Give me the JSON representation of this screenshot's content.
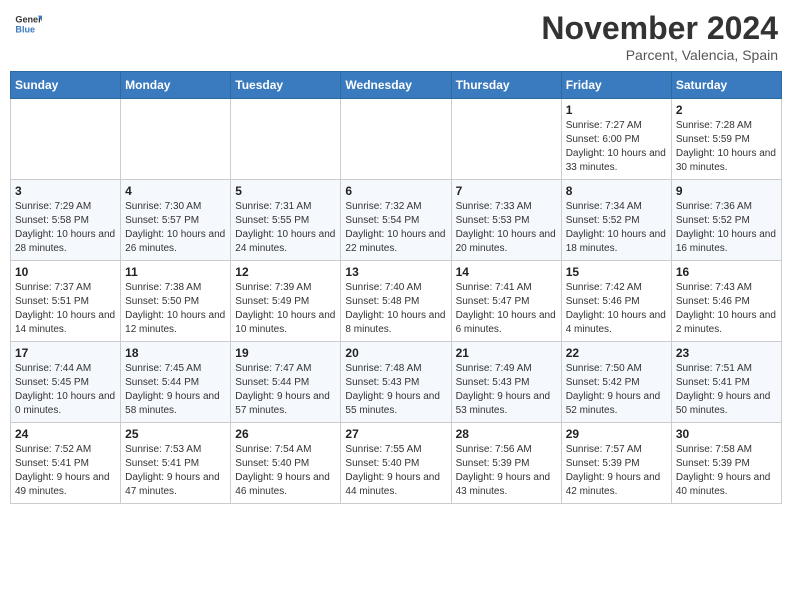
{
  "logo": {
    "line1": "General",
    "line2": "Blue"
  },
  "title": "November 2024",
  "subtitle": "Parcent, Valencia, Spain",
  "weekdays": [
    "Sunday",
    "Monday",
    "Tuesday",
    "Wednesday",
    "Thursday",
    "Friday",
    "Saturday"
  ],
  "weeks": [
    [
      {
        "day": "",
        "info": ""
      },
      {
        "day": "",
        "info": ""
      },
      {
        "day": "",
        "info": ""
      },
      {
        "day": "",
        "info": ""
      },
      {
        "day": "",
        "info": ""
      },
      {
        "day": "1",
        "info": "Sunrise: 7:27 AM\nSunset: 6:00 PM\nDaylight: 10 hours and 33 minutes."
      },
      {
        "day": "2",
        "info": "Sunrise: 7:28 AM\nSunset: 5:59 PM\nDaylight: 10 hours and 30 minutes."
      }
    ],
    [
      {
        "day": "3",
        "info": "Sunrise: 7:29 AM\nSunset: 5:58 PM\nDaylight: 10 hours and 28 minutes."
      },
      {
        "day": "4",
        "info": "Sunrise: 7:30 AM\nSunset: 5:57 PM\nDaylight: 10 hours and 26 minutes."
      },
      {
        "day": "5",
        "info": "Sunrise: 7:31 AM\nSunset: 5:55 PM\nDaylight: 10 hours and 24 minutes."
      },
      {
        "day": "6",
        "info": "Sunrise: 7:32 AM\nSunset: 5:54 PM\nDaylight: 10 hours and 22 minutes."
      },
      {
        "day": "7",
        "info": "Sunrise: 7:33 AM\nSunset: 5:53 PM\nDaylight: 10 hours and 20 minutes."
      },
      {
        "day": "8",
        "info": "Sunrise: 7:34 AM\nSunset: 5:52 PM\nDaylight: 10 hours and 18 minutes."
      },
      {
        "day": "9",
        "info": "Sunrise: 7:36 AM\nSunset: 5:52 PM\nDaylight: 10 hours and 16 minutes."
      }
    ],
    [
      {
        "day": "10",
        "info": "Sunrise: 7:37 AM\nSunset: 5:51 PM\nDaylight: 10 hours and 14 minutes."
      },
      {
        "day": "11",
        "info": "Sunrise: 7:38 AM\nSunset: 5:50 PM\nDaylight: 10 hours and 12 minutes."
      },
      {
        "day": "12",
        "info": "Sunrise: 7:39 AM\nSunset: 5:49 PM\nDaylight: 10 hours and 10 minutes."
      },
      {
        "day": "13",
        "info": "Sunrise: 7:40 AM\nSunset: 5:48 PM\nDaylight: 10 hours and 8 minutes."
      },
      {
        "day": "14",
        "info": "Sunrise: 7:41 AM\nSunset: 5:47 PM\nDaylight: 10 hours and 6 minutes."
      },
      {
        "day": "15",
        "info": "Sunrise: 7:42 AM\nSunset: 5:46 PM\nDaylight: 10 hours and 4 minutes."
      },
      {
        "day": "16",
        "info": "Sunrise: 7:43 AM\nSunset: 5:46 PM\nDaylight: 10 hours and 2 minutes."
      }
    ],
    [
      {
        "day": "17",
        "info": "Sunrise: 7:44 AM\nSunset: 5:45 PM\nDaylight: 10 hours and 0 minutes."
      },
      {
        "day": "18",
        "info": "Sunrise: 7:45 AM\nSunset: 5:44 PM\nDaylight: 9 hours and 58 minutes."
      },
      {
        "day": "19",
        "info": "Sunrise: 7:47 AM\nSunset: 5:44 PM\nDaylight: 9 hours and 57 minutes."
      },
      {
        "day": "20",
        "info": "Sunrise: 7:48 AM\nSunset: 5:43 PM\nDaylight: 9 hours and 55 minutes."
      },
      {
        "day": "21",
        "info": "Sunrise: 7:49 AM\nSunset: 5:43 PM\nDaylight: 9 hours and 53 minutes."
      },
      {
        "day": "22",
        "info": "Sunrise: 7:50 AM\nSunset: 5:42 PM\nDaylight: 9 hours and 52 minutes."
      },
      {
        "day": "23",
        "info": "Sunrise: 7:51 AM\nSunset: 5:41 PM\nDaylight: 9 hours and 50 minutes."
      }
    ],
    [
      {
        "day": "24",
        "info": "Sunrise: 7:52 AM\nSunset: 5:41 PM\nDaylight: 9 hours and 49 minutes."
      },
      {
        "day": "25",
        "info": "Sunrise: 7:53 AM\nSunset: 5:41 PM\nDaylight: 9 hours and 47 minutes."
      },
      {
        "day": "26",
        "info": "Sunrise: 7:54 AM\nSunset: 5:40 PM\nDaylight: 9 hours and 46 minutes."
      },
      {
        "day": "27",
        "info": "Sunrise: 7:55 AM\nSunset: 5:40 PM\nDaylight: 9 hours and 44 minutes."
      },
      {
        "day": "28",
        "info": "Sunrise: 7:56 AM\nSunset: 5:39 PM\nDaylight: 9 hours and 43 minutes."
      },
      {
        "day": "29",
        "info": "Sunrise: 7:57 AM\nSunset: 5:39 PM\nDaylight: 9 hours and 42 minutes."
      },
      {
        "day": "30",
        "info": "Sunrise: 7:58 AM\nSunset: 5:39 PM\nDaylight: 9 hours and 40 minutes."
      }
    ]
  ]
}
